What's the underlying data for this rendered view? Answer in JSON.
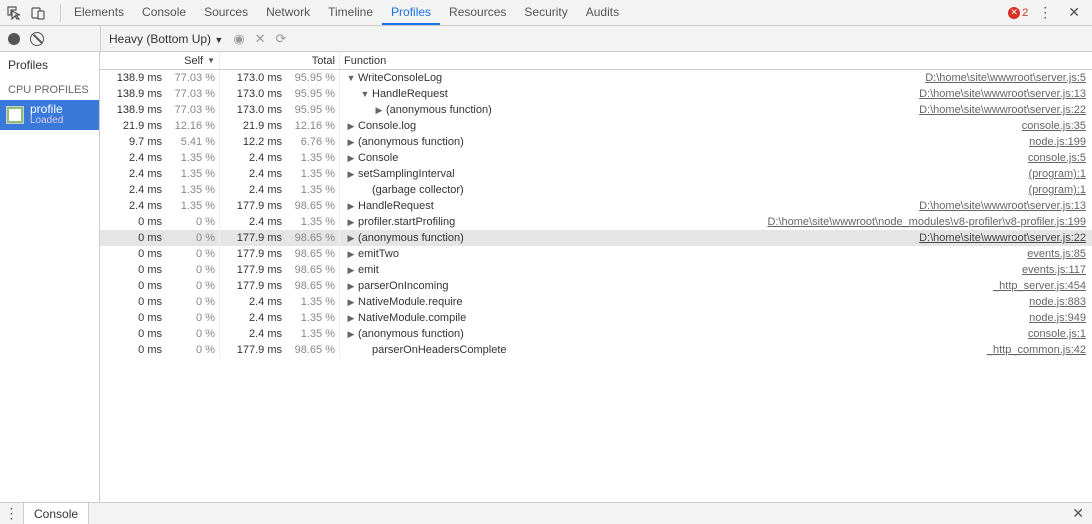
{
  "tabs": [
    "Elements",
    "Console",
    "Sources",
    "Network",
    "Timeline",
    "Profiles",
    "Resources",
    "Security",
    "Audits"
  ],
  "active_tab": 5,
  "errors_count": "2",
  "subbar": {
    "mode_label": "Heavy (Bottom Up)"
  },
  "sidebar": {
    "title": "Profiles",
    "section": "CPU PROFILES",
    "item": {
      "name": "profile",
      "status": "Loaded"
    }
  },
  "columns": {
    "self": "Self",
    "total": "Total",
    "func": "Function"
  },
  "selected_row": 10,
  "rows": [
    {
      "self_ms": "138.9 ms",
      "self_pct": "77.03 %",
      "total_ms": "173.0 ms",
      "total_pct": "95.95 %",
      "indent": 0,
      "arrow": "down",
      "name": "WriteConsoleLog",
      "loc": "D:\\home\\site\\wwwroot\\server.js:5"
    },
    {
      "self_ms": "138.9 ms",
      "self_pct": "77.03 %",
      "total_ms": "173.0 ms",
      "total_pct": "95.95 %",
      "indent": 1,
      "arrow": "down",
      "name": "HandleRequest",
      "loc": "D:\\home\\site\\wwwroot\\server.js:13"
    },
    {
      "self_ms": "138.9 ms",
      "self_pct": "77.03 %",
      "total_ms": "173.0 ms",
      "total_pct": "95.95 %",
      "indent": 2,
      "arrow": "right",
      "name": "(anonymous function)",
      "loc": "D:\\home\\site\\wwwroot\\server.js:22"
    },
    {
      "self_ms": "21.9 ms",
      "self_pct": "12.16 %",
      "total_ms": "21.9 ms",
      "total_pct": "12.16 %",
      "indent": 0,
      "arrow": "right",
      "name": "Console.log",
      "loc": "console.js:35"
    },
    {
      "self_ms": "9.7 ms",
      "self_pct": "5.41 %",
      "total_ms": "12.2 ms",
      "total_pct": "6.76 %",
      "indent": 0,
      "arrow": "right",
      "name": "(anonymous function)",
      "loc": "node.js:199"
    },
    {
      "self_ms": "2.4 ms",
      "self_pct": "1.35 %",
      "total_ms": "2.4 ms",
      "total_pct": "1.35 %",
      "indent": 0,
      "arrow": "right",
      "name": "Console",
      "loc": "console.js:5"
    },
    {
      "self_ms": "2.4 ms",
      "self_pct": "1.35 %",
      "total_ms": "2.4 ms",
      "total_pct": "1.35 %",
      "indent": 0,
      "arrow": "right",
      "name": "setSamplingInterval",
      "loc": "(program):1"
    },
    {
      "self_ms": "2.4 ms",
      "self_pct": "1.35 %",
      "total_ms": "2.4 ms",
      "total_pct": "1.35 %",
      "indent": 1,
      "arrow": "none",
      "name": "(garbage collector)",
      "loc": "(program):1"
    },
    {
      "self_ms": "2.4 ms",
      "self_pct": "1.35 %",
      "total_ms": "177.9 ms",
      "total_pct": "98.65 %",
      "indent": 0,
      "arrow": "right",
      "name": "HandleRequest",
      "loc": "D:\\home\\site\\wwwroot\\server.js:13"
    },
    {
      "self_ms": "0 ms",
      "self_pct": "0 %",
      "total_ms": "2.4 ms",
      "total_pct": "1.35 %",
      "indent": 0,
      "arrow": "right",
      "name": "profiler.startProfiling",
      "loc": "D:\\home\\site\\wwwroot\\node_modules\\v8-profiler\\v8-profiler.js:199"
    },
    {
      "self_ms": "0 ms",
      "self_pct": "0 %",
      "total_ms": "177.9 ms",
      "total_pct": "98.65 %",
      "indent": 0,
      "arrow": "right",
      "name": "(anonymous function)",
      "loc": "D:\\home\\site\\wwwroot\\server.js:22"
    },
    {
      "self_ms": "0 ms",
      "self_pct": "0 %",
      "total_ms": "177.9 ms",
      "total_pct": "98.65 %",
      "indent": 0,
      "arrow": "right",
      "name": "emitTwo",
      "loc": "events.js:85"
    },
    {
      "self_ms": "0 ms",
      "self_pct": "0 %",
      "total_ms": "177.9 ms",
      "total_pct": "98.65 %",
      "indent": 0,
      "arrow": "right",
      "name": "emit",
      "loc": "events.js:117"
    },
    {
      "self_ms": "0 ms",
      "self_pct": "0 %",
      "total_ms": "177.9 ms",
      "total_pct": "98.65 %",
      "indent": 0,
      "arrow": "right",
      "name": "parserOnIncoming",
      "loc": "_http_server.js:454"
    },
    {
      "self_ms": "0 ms",
      "self_pct": "0 %",
      "total_ms": "2.4 ms",
      "total_pct": "1.35 %",
      "indent": 0,
      "arrow": "right",
      "name": "NativeModule.require",
      "loc": "node.js:883"
    },
    {
      "self_ms": "0 ms",
      "self_pct": "0 %",
      "total_ms": "2.4 ms",
      "total_pct": "1.35 %",
      "indent": 0,
      "arrow": "right",
      "name": "NativeModule.compile",
      "loc": "node.js:949"
    },
    {
      "self_ms": "0 ms",
      "self_pct": "0 %",
      "total_ms": "2.4 ms",
      "total_pct": "1.35 %",
      "indent": 0,
      "arrow": "right",
      "name": "(anonymous function)",
      "loc": "console.js:1"
    },
    {
      "self_ms": "0 ms",
      "self_pct": "0 %",
      "total_ms": "177.9 ms",
      "total_pct": "98.65 %",
      "indent": 1,
      "arrow": "none",
      "name": "parserOnHeadersComplete",
      "loc": "_http_common.js:42"
    }
  ],
  "drawer": {
    "tab": "Console"
  }
}
